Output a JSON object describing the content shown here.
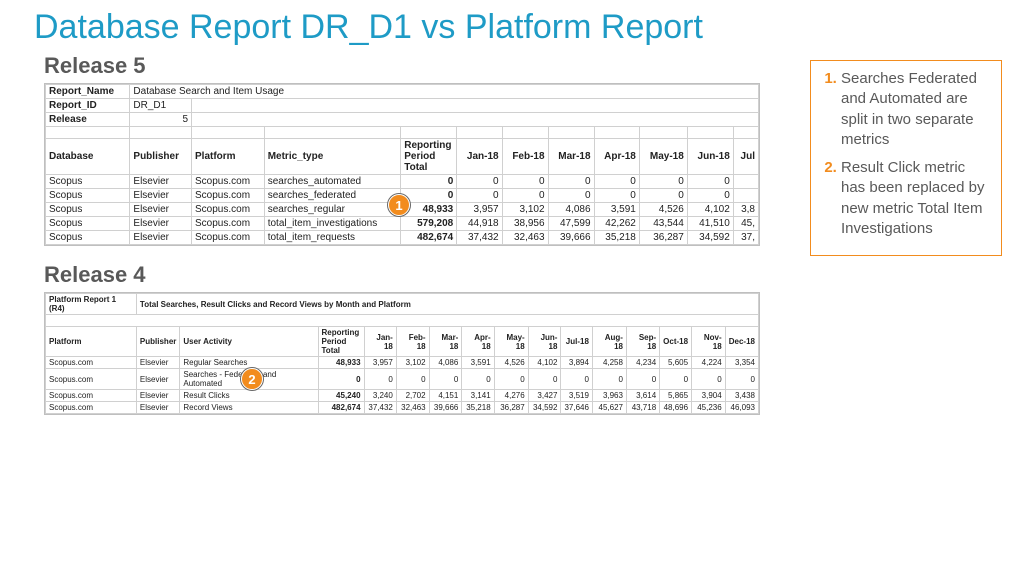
{
  "title": "Database Report DR_D1 vs Platform Report",
  "r5": {
    "header": "Release 5",
    "meta": {
      "report_name_label": "Report_Name",
      "report_name_value": "Database Search and Item Usage",
      "report_id_label": "Report_ID",
      "report_id_value": "DR_D1",
      "release_label": "Release",
      "release_value": "5"
    },
    "cols": {
      "database": "Database",
      "publisher": "Publisher",
      "platform": "Platform",
      "metric_type": "Metric_type",
      "rpt": "Reporting Period Total",
      "m1": "Jan-18",
      "m2": "Feb-18",
      "m3": "Mar-18",
      "m4": "Apr-18",
      "m5": "May-18",
      "m6": "Jun-18",
      "m7": "Jul"
    },
    "rows": [
      {
        "db": "Scopus",
        "pub": "Elsevier",
        "plat": "Scopus.com",
        "metric": "searches_automated",
        "tot": "0",
        "v": [
          "0",
          "0",
          "0",
          "0",
          "0",
          "0",
          ""
        ]
      },
      {
        "db": "Scopus",
        "pub": "Elsevier",
        "plat": "Scopus.com",
        "metric": "searches_federated",
        "tot": "0",
        "v": [
          "0",
          "0",
          "0",
          "0",
          "0",
          "0",
          ""
        ]
      },
      {
        "db": "Scopus",
        "pub": "Elsevier",
        "plat": "Scopus.com",
        "metric": "searches_regular",
        "tot": "48,933",
        "v": [
          "3,957",
          "3,102",
          "4,086",
          "3,591",
          "4,526",
          "4,102",
          "3,8"
        ]
      },
      {
        "db": "Scopus",
        "pub": "Elsevier",
        "plat": "Scopus.com",
        "metric": "total_item_investigations",
        "tot": "579,208",
        "v": [
          "44,918",
          "38,956",
          "47,599",
          "42,262",
          "43,544",
          "41,510",
          "45,"
        ]
      },
      {
        "db": "Scopus",
        "pub": "Elsevier",
        "plat": "Scopus.com",
        "metric": "total_item_requests",
        "tot": "482,674",
        "v": [
          "37,432",
          "32,463",
          "39,666",
          "35,218",
          "36,287",
          "34,592",
          "37,"
        ]
      }
    ]
  },
  "r4": {
    "header": "Release 4",
    "report_label": "Platform Report 1 (R4)",
    "report_desc": "Total Searches, Result Clicks and Record Views by Month and Platform",
    "cols": {
      "platform": "Platform",
      "publisher": "Publisher",
      "activity": "User Activity",
      "rpt": "Reporting Period Total",
      "m1": "Jan-18",
      "m2": "Feb-18",
      "m3": "Mar-18",
      "m4": "Apr-18",
      "m5": "May-18",
      "m6": "Jun-18",
      "m7": "Jul-18",
      "m8": "Aug-18",
      "m9": "Sep-18",
      "m10": "Oct-18",
      "m11": "Nov-18",
      "m12": "Dec-18"
    },
    "rows": [
      {
        "plat": "Scopus.com",
        "pub": "Elsevier",
        "act": "Regular Searches",
        "tot": "48,933",
        "v": [
          "3,957",
          "3,102",
          "4,086",
          "3,591",
          "4,526",
          "4,102",
          "3,894",
          "4,258",
          "4,234",
          "5,605",
          "4,224",
          "3,354"
        ]
      },
      {
        "plat": "Scopus.com",
        "pub": "Elsevier",
        "act": "Searches - Federated and Automated",
        "tot": "0",
        "v": [
          "0",
          "0",
          "0",
          "0",
          "0",
          "0",
          "0",
          "0",
          "0",
          "0",
          "0",
          "0"
        ]
      },
      {
        "plat": "Scopus.com",
        "pub": "Elsevier",
        "act": "Result Clicks",
        "tot": "45,240",
        "v": [
          "3,240",
          "2,702",
          "4,151",
          "3,141",
          "4,276",
          "3,427",
          "3,519",
          "3,963",
          "3,614",
          "5,865",
          "3,904",
          "3,438"
        ]
      },
      {
        "plat": "Scopus.com",
        "pub": "Elsevier",
        "act": "Record Views",
        "tot": "482,674",
        "v": [
          "37,432",
          "32,463",
          "39,666",
          "35,218",
          "36,287",
          "34,592",
          "37,646",
          "45,627",
          "43,718",
          "48,696",
          "45,236",
          "46,093"
        ]
      }
    ]
  },
  "notes": {
    "n1": "Searches Federated and Automated are split in two separate metrics",
    "n2": "Result Click metric has been replaced by new metric Total Item Investigations"
  },
  "callouts": {
    "c1": "1",
    "c2": "2"
  }
}
